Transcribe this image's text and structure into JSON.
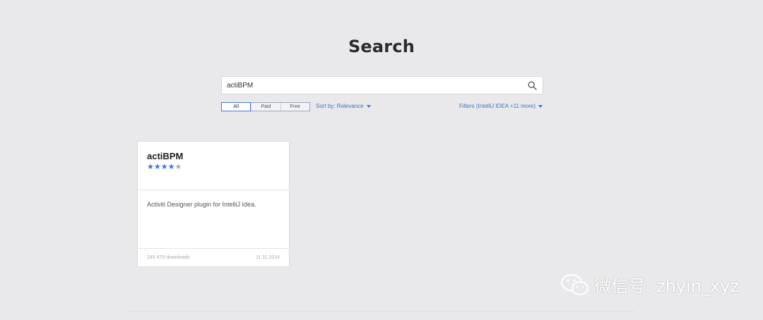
{
  "page": {
    "title": "Search"
  },
  "search": {
    "value": "actiBPM",
    "placeholder": ""
  },
  "pricing_filter": {
    "options": [
      "All",
      "Paid",
      "Free"
    ],
    "selected": "All"
  },
  "sort": {
    "label": "Sort by: Relevance"
  },
  "filters": {
    "label": "Filters (IntelliJ IDEA +11 more)"
  },
  "results": [
    {
      "name": "actiBPM",
      "rating": 4,
      "rating_max": 5,
      "description": "Activiti Designer plugin for IntelliJ Idea.",
      "downloads": "245 479 downloads",
      "date": "11.11.2014"
    }
  ],
  "watermark": {
    "text": "微信号: zhyin_xyz",
    "logo": "wechat-logo-icon"
  },
  "colors": {
    "accent": "#3f73c4",
    "star_filled": "#3d74d6",
    "background": "#e9e9eb"
  }
}
